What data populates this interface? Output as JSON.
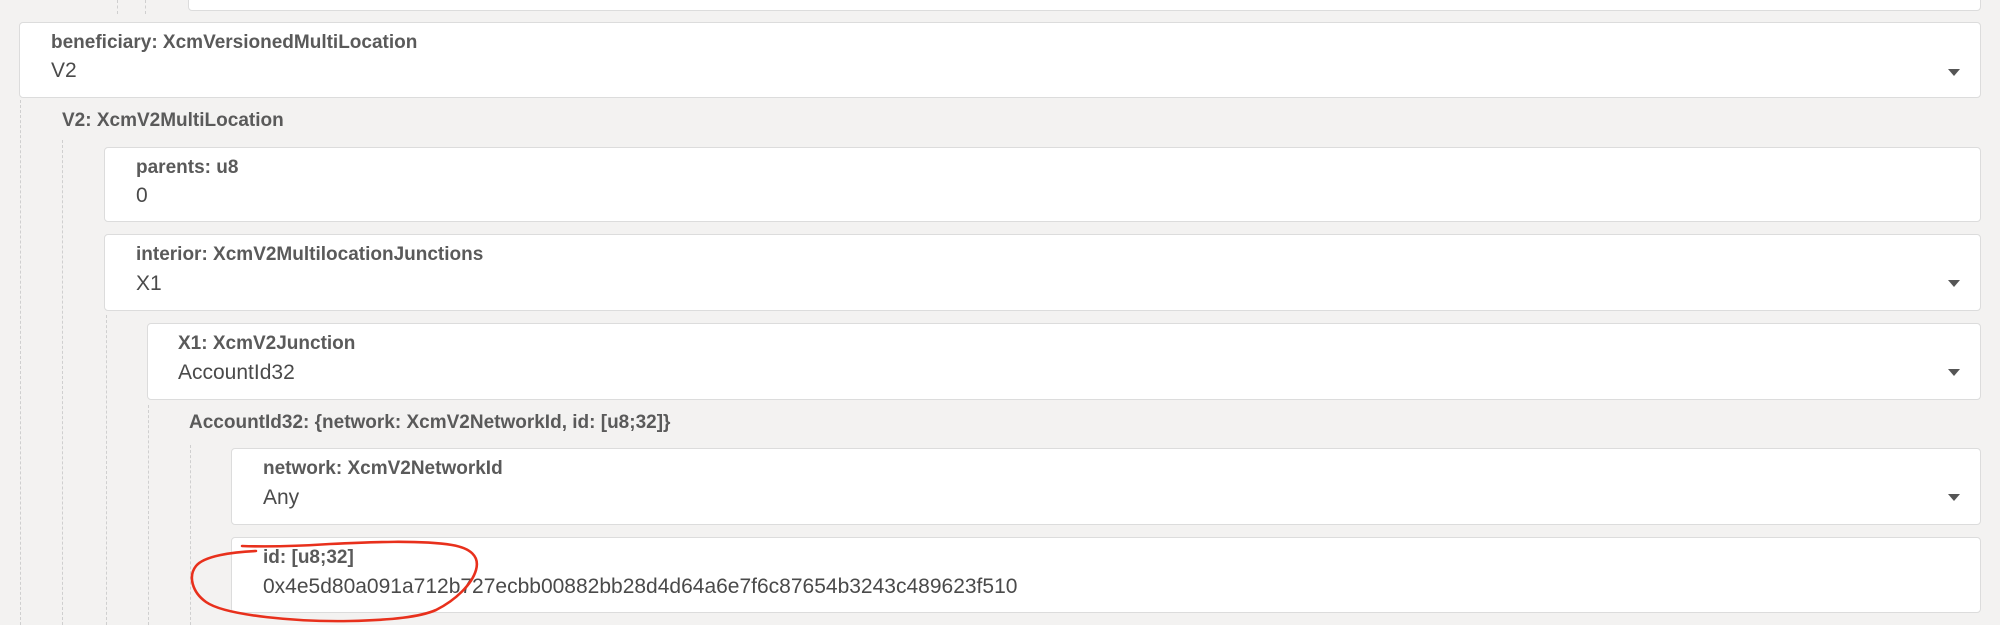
{
  "beneficiary": {
    "label": "beneficiary: XcmVersionedMultiLocation",
    "value": "V2",
    "caret_icon": "chevron-down-icon"
  },
  "v2_group": {
    "label": "V2: XcmV2MultiLocation"
  },
  "parents": {
    "label": "parents: u8",
    "value": "0"
  },
  "interior": {
    "label": "interior: XcmV2MultilocationJunctions",
    "value": "X1",
    "caret_icon": "chevron-down-icon"
  },
  "x1": {
    "label": "X1: XcmV2Junction",
    "value": "AccountId32",
    "caret_icon": "chevron-down-icon"
  },
  "accountid32_group": {
    "label": "AccountId32: {network: XcmV2NetworkId, id: [u8;32]}"
  },
  "network": {
    "label": "network: XcmV2NetworkId",
    "value": "Any",
    "caret_icon": "chevron-down-icon"
  },
  "id": {
    "label": "id: [u8;32]",
    "value": "0x4e5d80a091a712b727ecbb00882bb28d4d64a6e7f6c87654b3243c489623f510"
  },
  "colors": {
    "background": "#f3f2f1",
    "card": "#ffffff",
    "annotation": "#e8301c"
  }
}
